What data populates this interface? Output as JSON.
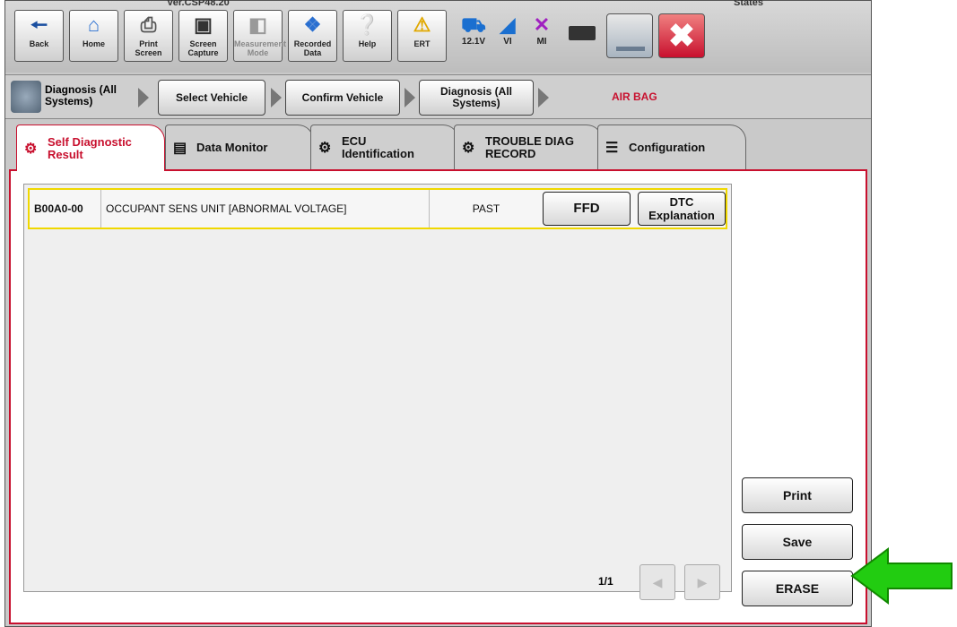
{
  "toolbar": {
    "version_label": "Ver.CSP48.20",
    "states_label": "States",
    "buttons": [
      {
        "label": "Back",
        "icon": "back-arrow"
      },
      {
        "label": "Home",
        "icon": "home"
      },
      {
        "label": "Print Screen",
        "icon": "printer"
      },
      {
        "label": "Screen Capture",
        "icon": "camera"
      },
      {
        "label": "Measurement Mode",
        "icon": "gauge"
      },
      {
        "label": "Recorded Data",
        "icon": "recorded-data"
      },
      {
        "label": "Help",
        "icon": "question"
      },
      {
        "label": "ERT",
        "icon": "warning"
      }
    ],
    "status": [
      {
        "label": "12.1V",
        "icon": "car"
      },
      {
        "label": "VI",
        "icon": "signal"
      },
      {
        "label": "MI",
        "icon": "x-mark"
      }
    ]
  },
  "breadcrumb": {
    "current": "Diagnosis (All Systems)",
    "steps": [
      "Select Vehicle",
      "Confirm Vehicle",
      "Diagnosis (All Systems)"
    ],
    "system": "AIR BAG"
  },
  "tabs": [
    "Self Diagnostic Result",
    "Data Monitor",
    "ECU Identification",
    "TROUBLE DIAG RECORD",
    "Configuration"
  ],
  "dtc": {
    "code": "B00A0-00",
    "description": "OCCUPANT SENS UNIT [ABNORMAL VOLTAGE]",
    "status": "PAST",
    "ffd_label": "FFD",
    "explanation_label": "DTC Explanation"
  },
  "pager": {
    "page": "1/1"
  },
  "actions": {
    "print": "Print",
    "save": "Save",
    "erase": "ERASE"
  },
  "colors": {
    "accent": "#c8102e",
    "highlight": "#f0d800",
    "arrow": "#22cc11"
  }
}
